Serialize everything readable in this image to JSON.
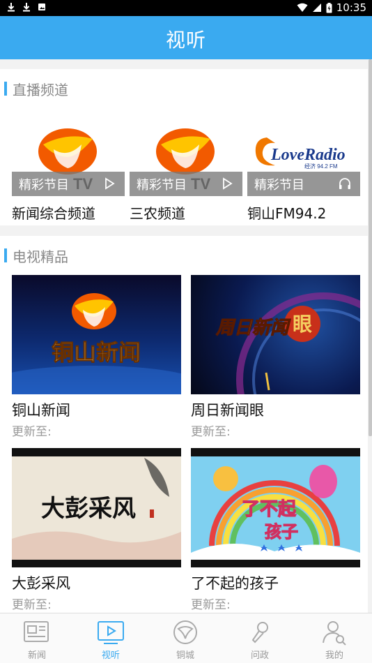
{
  "status_bar": {
    "time": "10:35",
    "left_icons": [
      "download-icon",
      "download-icon",
      "photo-icon"
    ],
    "right_icons": [
      "wifi-icon",
      "signal-icon",
      "battery-icon"
    ]
  },
  "header": {
    "title": "视听"
  },
  "live_section": {
    "title": "直播频道",
    "channels": [
      {
        "name": "新闻综合频道",
        "overlay_label": "精彩节目",
        "logo_text": "TV",
        "icon": "play-icon"
      },
      {
        "name": "三农频道",
        "overlay_label": "精彩节目",
        "logo_text": "TV",
        "icon": "play-icon"
      },
      {
        "name": "铜山FM94.2",
        "overlay_label": "精彩节目",
        "logo_text": "LoveRadio",
        "logo_subtext": "经济 94.2 FM",
        "icon": "headphones-icon"
      }
    ]
  },
  "tv_section": {
    "title": "电视精品",
    "programs": [
      {
        "name": "铜山新闻",
        "update_label": "更新至:",
        "image_text": "铜山新闻"
      },
      {
        "name": "周日新闻眼",
        "update_label": "更新至:",
        "image_text": "周日新闻",
        "image_text2": "眼"
      },
      {
        "name": "大彭采风",
        "update_label": "更新至:",
        "image_text": "大彭采风"
      },
      {
        "name": "了不起的孩子",
        "update_label": "更新至:",
        "image_text": "了不起",
        "image_text2": "孩子"
      }
    ]
  },
  "bottom_nav": {
    "active": "视听",
    "items": [
      {
        "label": "新闻",
        "icon": "newspaper-icon"
      },
      {
        "label": "视听",
        "icon": "video-play-icon"
      },
      {
        "label": "铜城",
        "icon": "city-emblem-icon"
      },
      {
        "label": "问政",
        "icon": "microphone-icon"
      },
      {
        "label": "我的",
        "icon": "user-search-icon"
      }
    ]
  },
  "colors": {
    "accent": "#3aaaf0",
    "logo_orange": "#f25a00",
    "logo_yellow": "#ffc400"
  }
}
